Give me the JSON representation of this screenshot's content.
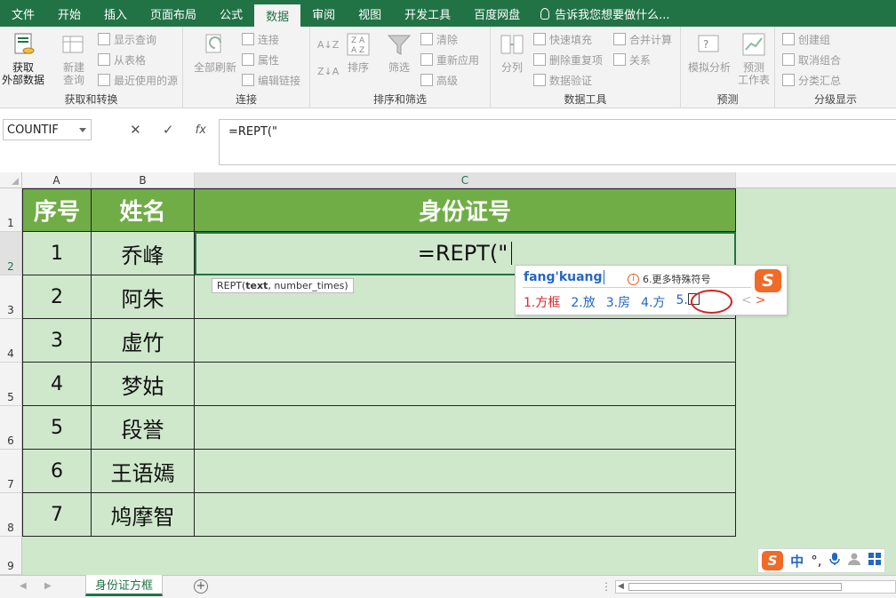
{
  "tabs": [
    {
      "label": "文件",
      "active": false
    },
    {
      "label": "开始",
      "active": false
    },
    {
      "label": "插入",
      "active": false
    },
    {
      "label": "页面布局",
      "active": false
    },
    {
      "label": "公式",
      "active": false
    },
    {
      "label": "数据",
      "active": true
    },
    {
      "label": "审阅",
      "active": false
    },
    {
      "label": "视图",
      "active": false
    },
    {
      "label": "开发工具",
      "active": false
    },
    {
      "label": "百度网盘",
      "active": false
    }
  ],
  "tell_me": "告诉我您想要做什么...",
  "ribbon": {
    "get_external": {
      "line1": "获取",
      "line2": "外部数据"
    },
    "new_query": {
      "line1": "新建",
      "line2": "查询"
    },
    "show_query": "显示查询",
    "from_table": "从表格",
    "recent_sources": "最近使用的源",
    "group_get_transform": "获取和转换",
    "refresh_all": "全部刷新",
    "connections": "连接",
    "properties": "属性",
    "edit_links": "编辑链接",
    "group_connections": "连接",
    "sort": "排序",
    "filter": "筛选",
    "clear": "清除",
    "reapply": "重新应用",
    "advanced": "高级",
    "group_sort_filter": "排序和筛选",
    "split": "分列",
    "flash_fill": "快速填充",
    "remove_dup": "删除重复项",
    "data_validation": "数据验证",
    "consolidate": "合并计算",
    "relations": "关系",
    "group_data_tools": "数据工具",
    "whatif": "模拟分析",
    "forecast": {
      "line1": "预测",
      "line2": "工作表"
    },
    "group_forecast": "预测",
    "group_create": "创建组",
    "ungroup": "取消组合",
    "subtotal": "分类汇总",
    "group_outline": "分级显示"
  },
  "formula_bar": {
    "name_box": "COUNTIF",
    "cancel_symbol": "✕",
    "enter_symbol": "✓",
    "fx": "fx",
    "formula": "=REPT(\""
  },
  "columns": [
    "A",
    "B",
    "C"
  ],
  "row_numbers": [
    "1",
    "2",
    "3",
    "4",
    "5",
    "6",
    "7",
    "8",
    "9"
  ],
  "table": {
    "headers": [
      "序号",
      "姓名",
      "身份证号"
    ],
    "rows": [
      {
        "num": "1",
        "name": "乔峰"
      },
      {
        "num": "2",
        "name": "阿朱"
      },
      {
        "num": "3",
        "name": "虚竹"
      },
      {
        "num": "4",
        "name": "梦姑"
      },
      {
        "num": "5",
        "name": "段誉"
      },
      {
        "num": "6",
        "name": "王语嫣"
      },
      {
        "num": "7",
        "name": "鸠摩智"
      }
    ],
    "editing_value": "=REPT(\""
  },
  "tooltip": {
    "fn": "REPT(",
    "arg1": "text",
    "rest": ", number_times)"
  },
  "ime": {
    "composition": "fang'kuang",
    "more_symbols": "6.更多特殊符号",
    "logo": "S",
    "candidates": [
      "1.方框",
      "2.放",
      "3.房",
      "4.方",
      "5."
    ],
    "prev": "<",
    "next": ">"
  },
  "ime_status": {
    "logo": "S",
    "lang": "中",
    "punct": "°,"
  },
  "sheet": {
    "name": "身份证方框",
    "add": "+"
  }
}
